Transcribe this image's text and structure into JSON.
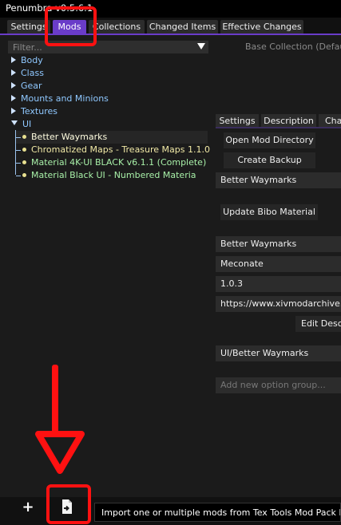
{
  "window": {
    "title": "Penumbra v0.5.6.1"
  },
  "tabs": [
    {
      "label": "Settings"
    },
    {
      "label": "Mods"
    },
    {
      "label": "Collections"
    },
    {
      "label": "Changed Items"
    },
    {
      "label": "Effective Changes"
    }
  ],
  "filter": {
    "placeholder": "Filter...",
    "value": ""
  },
  "base_collection": "Base Collection (Default)",
  "tree": {
    "folders": [
      {
        "label": "Body"
      },
      {
        "label": "Class"
      },
      {
        "label": "Gear"
      },
      {
        "label": "Mounts and Minions"
      },
      {
        "label": "Textures"
      },
      {
        "label": "UI"
      }
    ],
    "ui_mods": [
      {
        "label": "Better Waymarks",
        "color": "#fffde0"
      },
      {
        "label": "Chromatized Maps - Treasure Maps 1.1.0",
        "color": "#f1e9a6"
      },
      {
        "label": "Material 4K-UI BLACK v6.1.1 (Complete)",
        "color": "#a8f0a8"
      },
      {
        "label": "Material Black UI - Numbered Materia",
        "color": "#a8f0a8"
      }
    ]
  },
  "panel": {
    "tabs": [
      {
        "label": "Settings"
      },
      {
        "label": "Description"
      },
      {
        "label": "Cha"
      }
    ],
    "open_dir_label": "Open Mod Directory",
    "create_backup_label": "Create Backup",
    "mod_name": "Better Waymarks",
    "update_bibo_label": "Update Bibo Material",
    "name_field": "Better Waymarks",
    "author_field": "Meconate",
    "version_field": "1.0.3",
    "website_field": "https://www.xivmodarchive.c",
    "edit_desc_label": "Edit Descr",
    "path_field": "UI/Better Waymarks",
    "add_group_placeholder": "Add new option group..."
  },
  "bottom": {
    "add_icon": "plus-icon",
    "import_icon": "file-import-icon",
    "tooltip": "Import one or multiple mods from Tex Tools Mod Pack Files."
  },
  "colors": {
    "accent": "#6a3cc9",
    "folder": "#8fc8ff",
    "annotation": "#ff1111"
  }
}
